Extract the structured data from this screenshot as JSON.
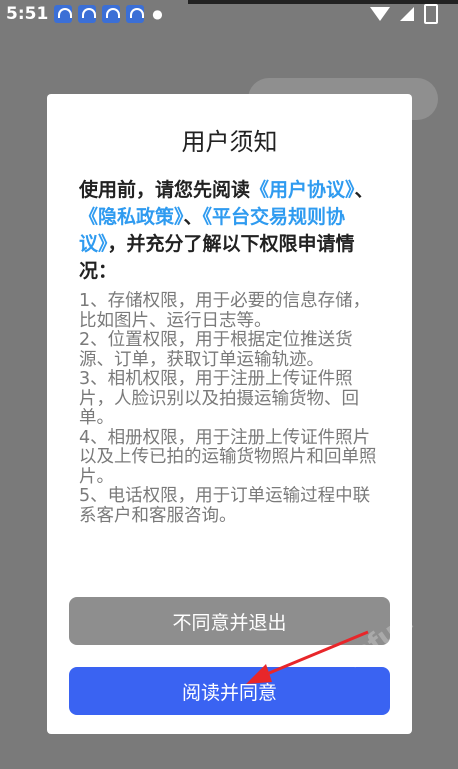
{
  "status_bar": {
    "time": "5:51"
  },
  "dialog": {
    "title": "用户须知",
    "intro": {
      "lead": "使用前，请您先阅读",
      "link_user": "《用户协议》",
      "sep1": "、",
      "link_privacy": "《隐私政策》",
      "sep2": "、",
      "link_platform": "《平台交易规则协议》",
      "tail": "，并充分了解以下权限申请情况："
    },
    "permissions": [
      "1、存储权限，用于必要的信息存储，比如图片、运行日志等。",
      "2、位置权限，用于根据定位推送货源、订单，获取订单运输轨迹。",
      "3、相机权限，用于注册上传证件照片，人脸识别以及拍摄运输货物、回单。",
      "4、相册权限，用于注册上传证件照片以及上传已拍的运输货物照片和回单照片。",
      "5、电话权限，用于订单运输过程中联系客户和客服咨询。"
    ],
    "disagree_label": "不同意并退出",
    "agree_label": "阅读并同意"
  },
  "watermark": "mfun",
  "colors": {
    "link": "#2f9bf0",
    "agree_button": "#3a63f2",
    "disagree_button": "#8e8e8e",
    "annotation_arrow": "#e8262a"
  }
}
